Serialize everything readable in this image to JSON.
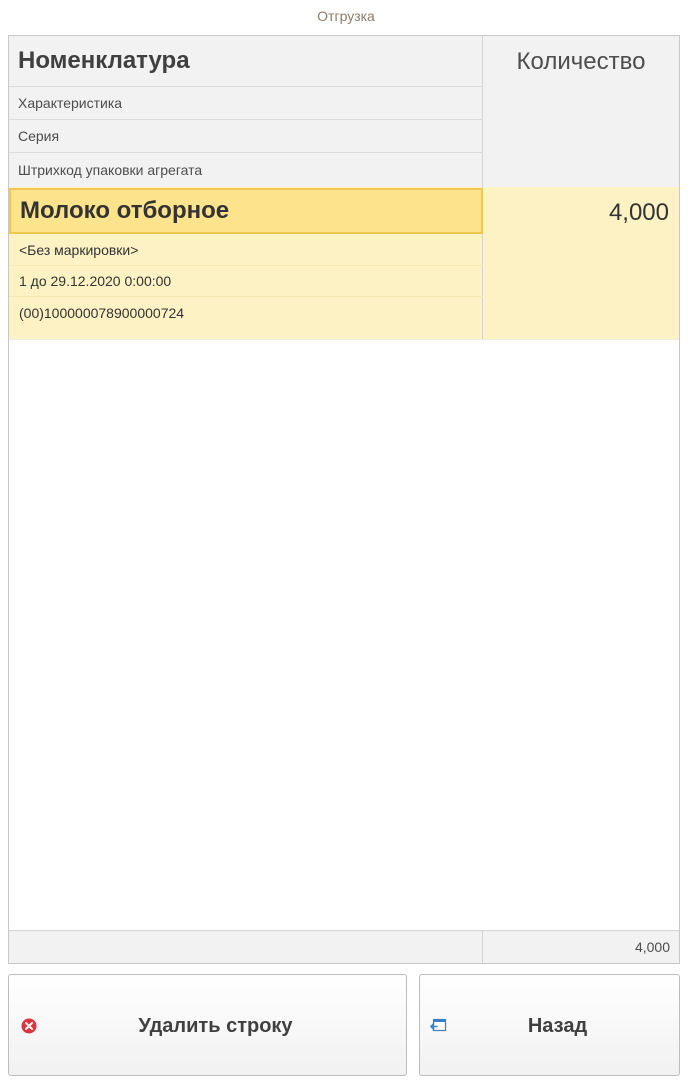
{
  "window": {
    "title": "Отгрузка"
  },
  "table": {
    "headers": {
      "name": "Номенклатура",
      "characteristic": "Характеристика",
      "series": "Серия",
      "barcode": "Штрихкод упаковки агрегата",
      "quantity": "Количество"
    },
    "rows": [
      {
        "name": "Молоко отборное",
        "characteristic": "<Без маркировки>",
        "series": "1 до 29.12.2020 0:00:00",
        "barcode": "(00)100000078900000724",
        "quantity": "4,000"
      }
    ],
    "footer": {
      "total_quantity": "4,000"
    }
  },
  "buttons": {
    "delete_label": "Удалить строку",
    "delete_icon": "delete-circle-icon",
    "back_label": "Назад",
    "back_icon": "back-arrow-icon"
  },
  "colors": {
    "selected_row": "#fdf2c4",
    "selected_cell": "#fde38c",
    "delete_icon": "#e0333c",
    "back_icon": "#3a7fc4"
  }
}
